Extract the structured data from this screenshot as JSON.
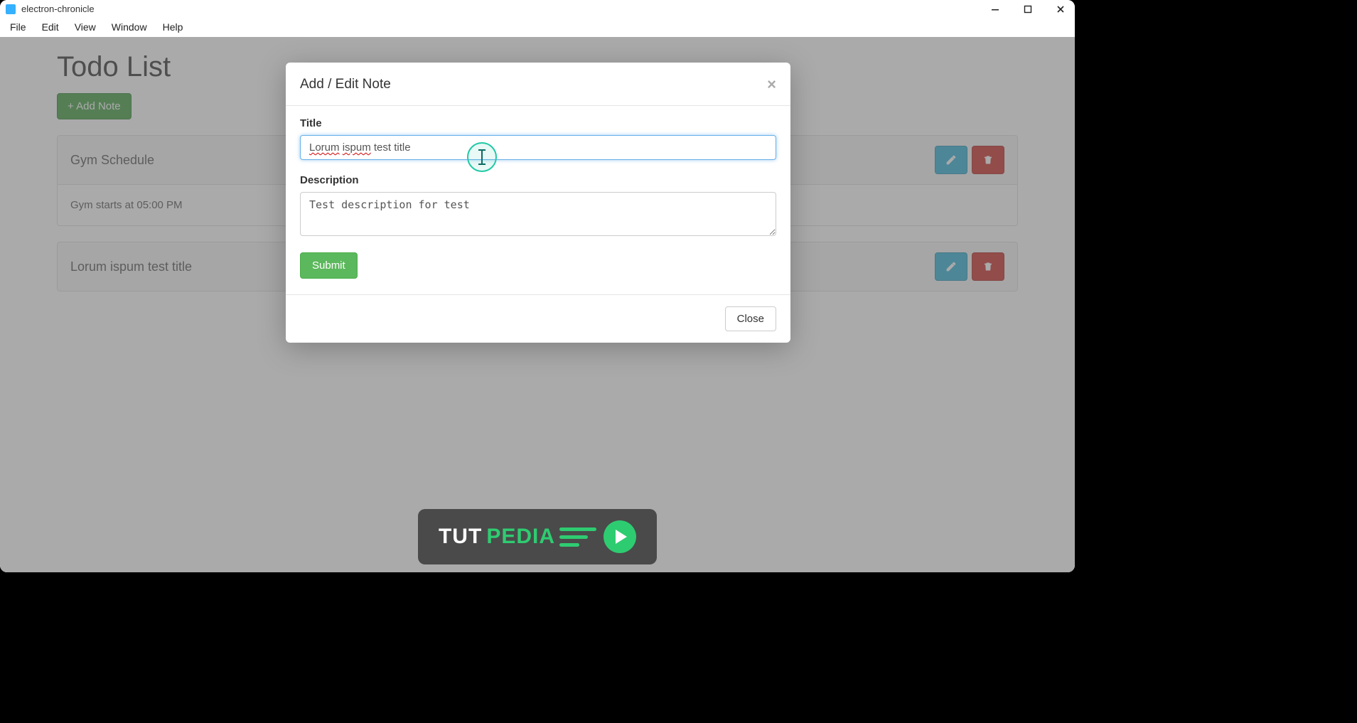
{
  "window": {
    "title": "electron-chronicle"
  },
  "menus": [
    "File",
    "Edit",
    "View",
    "Window",
    "Help"
  ],
  "page": {
    "heading": "Todo List",
    "add_note_label": "+ Add Note"
  },
  "notes": [
    {
      "title": "Gym Schedule",
      "body": "Gym starts at 05:00 PM"
    },
    {
      "title": "Lorum ispum test title",
      "body": ""
    }
  ],
  "modal": {
    "heading": "Add / Edit Note",
    "title_label": "Title",
    "title_value": "Lorum ispum test title",
    "title_misspelled_words": [
      "Lorum",
      "ispum"
    ],
    "description_label": "Description",
    "description_value": "Test description for test",
    "submit_label": "Submit",
    "close_label": "Close"
  },
  "watermark": {
    "part1": "TUT",
    "part2": "PEDIA"
  },
  "colors": {
    "primary_green": "#449d44",
    "success_green": "#5cb85c",
    "info_blue": "#31b0d5",
    "danger_red": "#c9302c",
    "focus_blue": "#66afe9",
    "indicator_teal": "#20c9a6",
    "brand_green": "#2ecc71"
  }
}
